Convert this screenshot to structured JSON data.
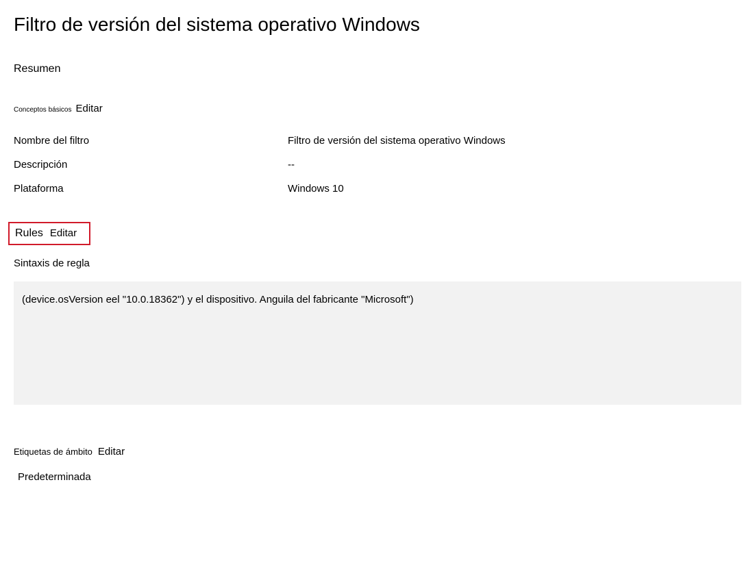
{
  "title": "Filtro de versión del sistema operativo Windows",
  "summary": "Resumen",
  "basics": {
    "label": "Conceptos básicos",
    "edit": "Editar",
    "rows": {
      "filter_name": {
        "label": "Nombre del filtro",
        "value": "Filtro de versión del sistema operativo Windows"
      },
      "description": {
        "label": "Descripción",
        "value": "--"
      },
      "platform": {
        "label": "Plataforma",
        "value": "Windows 10"
      }
    }
  },
  "rules": {
    "label": "Rules",
    "edit": "Editar",
    "syntax_label": "Sintaxis de regla",
    "syntax": "(device.osVersion eel \"10.0.18362\") y el dispositivo. Anguila del fabricante \"Microsoft\")"
  },
  "scope_tags": {
    "label": "Etiquetas de ámbito",
    "edit": "Editar",
    "default": "Predeterminada"
  }
}
